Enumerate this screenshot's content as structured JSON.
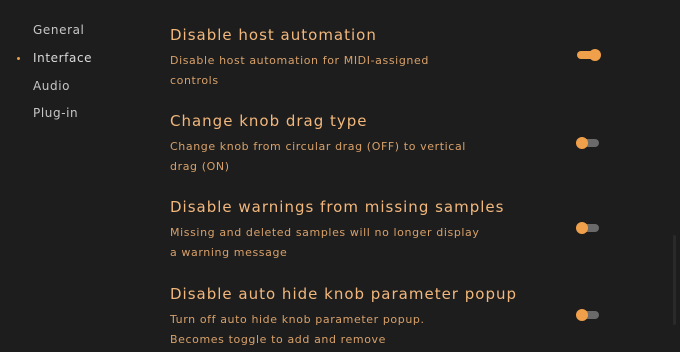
{
  "colors": {
    "background": "#1d1d1d",
    "accent": "#f0a04a",
    "title_text": "#f2b77c",
    "desc_text": "#d7a06a",
    "nav_text": "#c6c6c6",
    "toggle_off_track": "#6a6a6a"
  },
  "sidebar": {
    "items": [
      {
        "label": "General",
        "active": false
      },
      {
        "label": "Interface",
        "active": true
      },
      {
        "label": "Audio",
        "active": false
      },
      {
        "label": "Plug-in",
        "active": false
      }
    ],
    "active_marker_icon": "bullet-dot-icon"
  },
  "settings": [
    {
      "title": "Disable host automation",
      "description": "Disable host automation for MIDI-assigned controls",
      "toggle_on": true
    },
    {
      "title": "Change knob drag type",
      "description": "Change knob from circular drag (OFF) to vertical drag (ON)",
      "toggle_on": false
    },
    {
      "title": "Disable warnings from missing samples",
      "description": "Missing and deleted samples will no longer display a warning message",
      "toggle_on": false
    },
    {
      "title": "Disable auto hide knob parameter popup",
      "description": "Turn off auto hide knob parameter popup. Becomes toggle to add and remove",
      "toggle_on": false
    }
  ]
}
